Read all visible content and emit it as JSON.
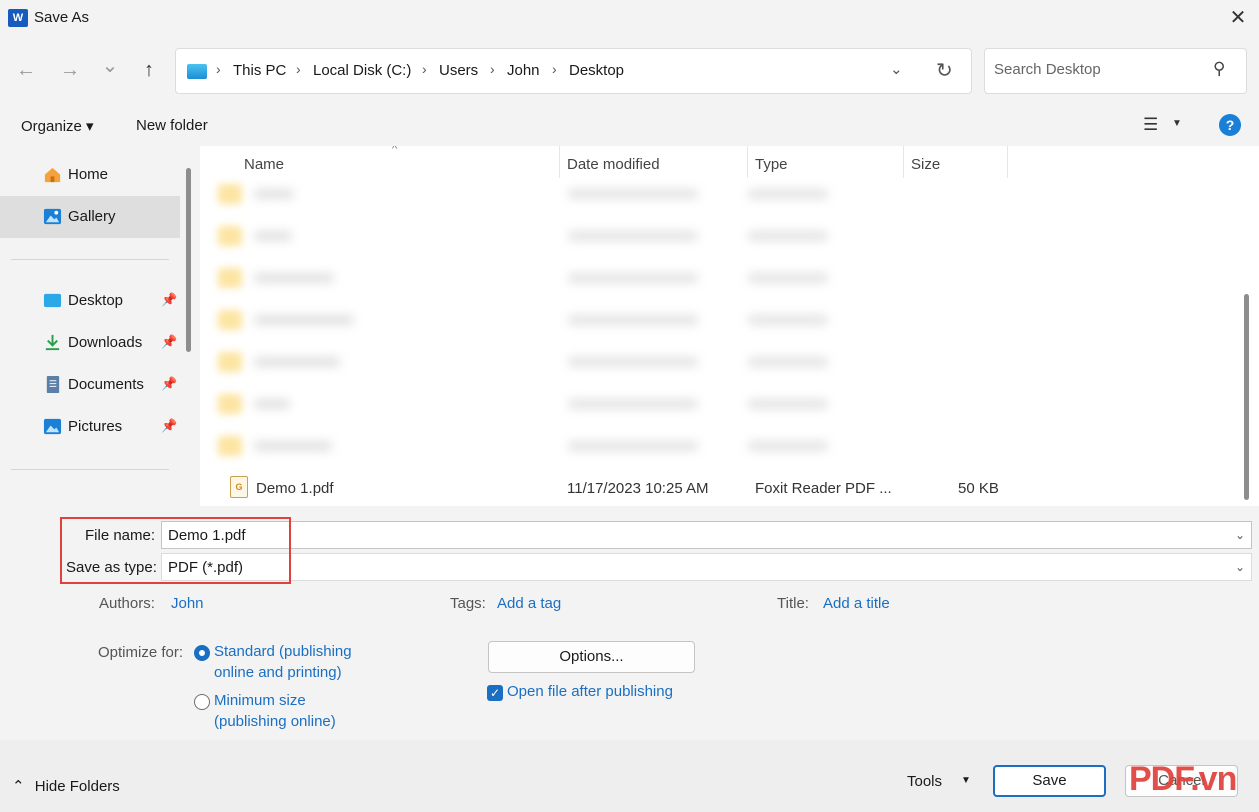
{
  "window": {
    "title": "Save As",
    "app_icon": "word-icon",
    "icon_letter": "W",
    "close_glyph": "✕"
  },
  "nav": {
    "back_glyph": "←",
    "forward_glyph": "→",
    "recent_glyph": "⌄",
    "up_glyph": "↑",
    "breadcrumb": [
      "This PC",
      "Local Disk (C:)",
      "Users",
      "John",
      "Desktop"
    ],
    "chevron": "›",
    "search_placeholder": "Search Desktop"
  },
  "commandbar": {
    "organize": "Organize ▾",
    "new_folder": "New folder",
    "help": "?"
  },
  "sidebar": {
    "items": [
      {
        "label": "Home",
        "icon": "home-icon"
      },
      {
        "label": "Gallery",
        "icon": "gallery-icon",
        "selected": true
      },
      {
        "label": "Desktop",
        "icon": "desktop-icon",
        "pinned": true
      },
      {
        "label": "Downloads",
        "icon": "downloads-icon",
        "pinned": true
      },
      {
        "label": "Documents",
        "icon": "documents-icon",
        "pinned": true
      },
      {
        "label": "Pictures",
        "icon": "pictures-icon",
        "pinned": true
      }
    ],
    "pin_glyph": "📌"
  },
  "filelist": {
    "columns": [
      "Name",
      "Date modified",
      "Type",
      "Size"
    ],
    "sort_glyph": "^",
    "blurred_folder_rows": 7,
    "file": {
      "name": "Demo 1.pdf",
      "date": "11/17/2023 10:25 AM",
      "type": "Foxit Reader PDF ...",
      "size": "50 KB",
      "icon_text": "G"
    }
  },
  "form": {
    "file_name_label": "File name:",
    "file_name_value": "Demo 1.pdf",
    "save_type_label": "Save as type:",
    "save_type_value": "PDF (*.pdf)",
    "authors_label": "Authors:",
    "authors_value": "John",
    "tags_label": "Tags:",
    "tags_value": "Add a tag",
    "title_label": "Title:",
    "title_value": "Add a title",
    "optimize_label": "Optimize for:",
    "opt_standard": [
      "Standard (publishing",
      "online and printing)"
    ],
    "opt_minimum": [
      "Minimum size",
      "(publishing online)"
    ],
    "options_button": "Options...",
    "open_after": "Open file after publishing",
    "checkmark": "✓"
  },
  "footer": {
    "hide_folders": "Hide Folders",
    "tools": "Tools",
    "save": "Save",
    "cancel": "Cancel"
  },
  "watermark": "PDF.vn",
  "colors": {
    "accent": "#1a6fc2",
    "highlight_box": "#e0413b"
  }
}
